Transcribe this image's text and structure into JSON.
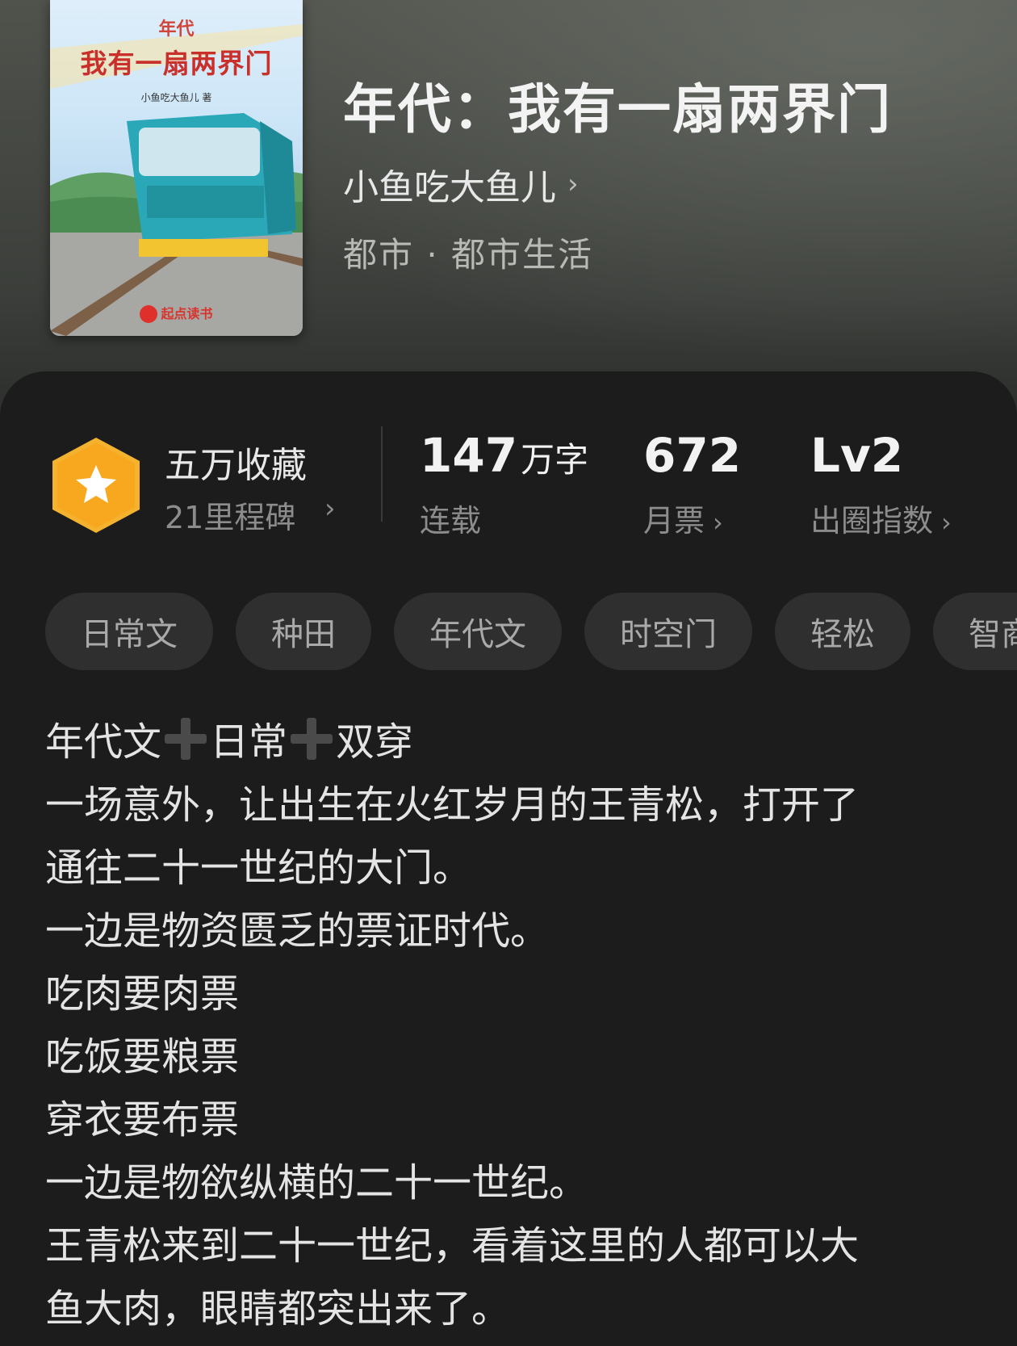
{
  "cover": {
    "genre": "年代",
    "title": "我有一扇两界门",
    "author": "小鱼吃大鱼儿 著",
    "brand": "起点读书"
  },
  "book": {
    "title": "年代：我有一扇两界门",
    "author": "小鱼吃大鱼儿",
    "category": "都市 · 都市生活"
  },
  "stats": {
    "favorites_title": "五万收藏",
    "favorites_sub": "21里程碑",
    "words_value": "147",
    "words_unit": "万字",
    "words_label": "连载",
    "monthly_tickets_value": "672",
    "monthly_tickets_label": "月票",
    "influence_value": "Lv2",
    "influence_label": "出圈指数"
  },
  "tags": [
    "日常文",
    "种田",
    "年代文",
    "时空门",
    "轻松",
    "智商"
  ],
  "synopsis": {
    "line1_a": "年代文",
    "line1_b": "日常",
    "line1_c": "双穿",
    "lines": [
      "一场意外，让出生在火红岁月的王青松，打开了",
      "通往二十一世纪的大门。",
      "一边是物资匮乏的票证时代。",
      "吃肉要肉票",
      "吃饭要粮票",
      "穿衣要布票",
      "一边是物欲纵横的二十一世纪。",
      "王青松来到二十一世纪，看着这里的人都可以大",
      "鱼大肉，眼睛都突出来了。"
    ]
  },
  "colors": {
    "badge": "#f5b22f",
    "card": "#1c1c1c",
    "tag_bg": "#2f2f2f"
  }
}
